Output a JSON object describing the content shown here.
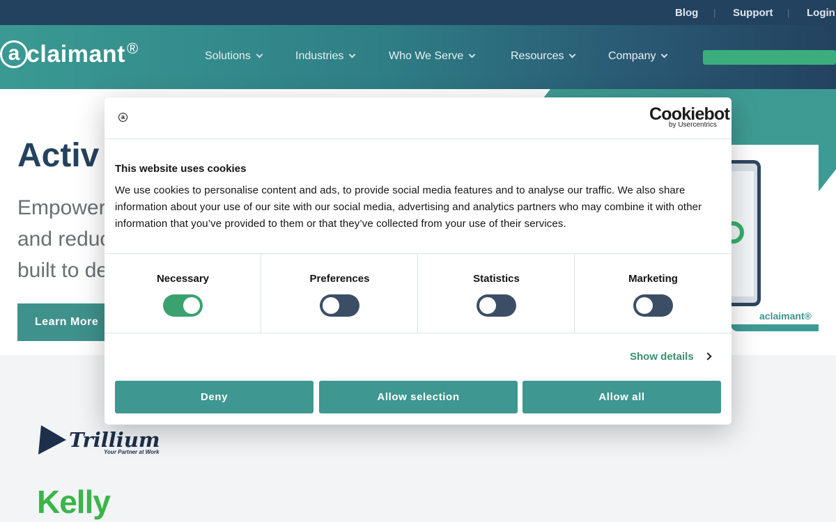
{
  "topbar": {
    "links": [
      "Blog",
      "Support",
      "Login"
    ],
    "separator": "|"
  },
  "nav": {
    "logo_letter": "a",
    "logo_text": "claimant",
    "logo_mark": "®",
    "items": [
      "Solutions",
      "Industries",
      "Who We Serve",
      "Resources",
      "Company"
    ]
  },
  "hero": {
    "title_partial": "Activ",
    "subtitle_lines": [
      "Empower",
      "and reduc",
      "built to de"
    ],
    "learn_more": "Learn More",
    "card_logo": "aclaimant®"
  },
  "clients": {
    "trillium": "Trillium",
    "trillium_tagline": "Your Partner at Work",
    "kelly": "Kelly"
  },
  "cookie_dialog": {
    "mini_logo": "a",
    "brand": "Cookiebot",
    "brand_sub": "by Usercentrics",
    "title": "This website uses cookies",
    "body": "We use cookies to personalise content and ads, to provide social media features and to analyse our traffic. We also share information about your use of our site with our social media, advertising and analytics partners who may combine it with other information that you’ve provided to them or that they’ve collected from your use of their services.",
    "categories": [
      {
        "label": "Necessary",
        "checked": true
      },
      {
        "label": "Preferences",
        "checked": false
      },
      {
        "label": "Statistics",
        "checked": false
      },
      {
        "label": "Marketing",
        "checked": false
      }
    ],
    "show_details": "Show details",
    "buttons": {
      "deny": "Deny",
      "allow_selection": "Allow selection",
      "allow_all": "Allow all"
    }
  },
  "colors": {
    "navy": "#23425f",
    "teal": "#3e9790",
    "green": "#3aa26f",
    "kelly_green": "#3bb54a"
  }
}
